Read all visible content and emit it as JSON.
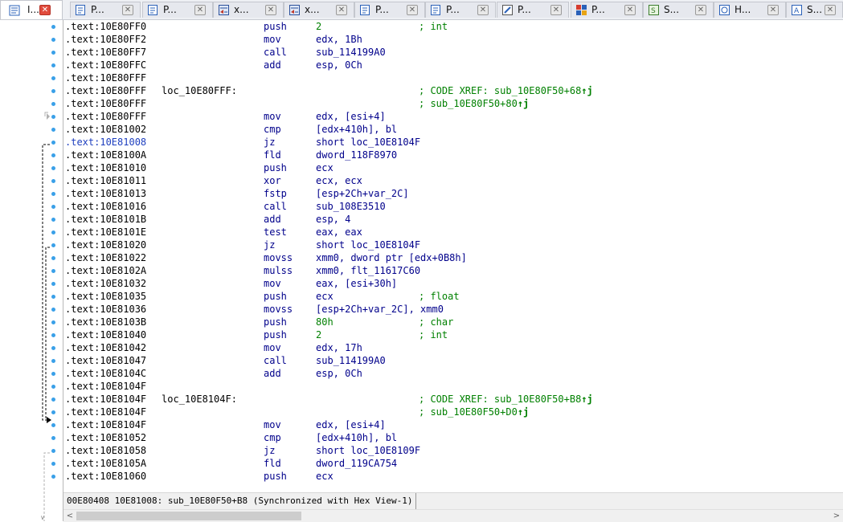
{
  "tabs": [
    {
      "label": "I...",
      "icon": "ida-view-icon",
      "active": true
    },
    {
      "label": "P...",
      "icon": "pseudocode-icon"
    },
    {
      "label": "P...",
      "icon": "pseudocode-icon"
    },
    {
      "label": "x...",
      "icon": "xrefs-icon"
    },
    {
      "label": "x...",
      "icon": "xrefs-icon"
    },
    {
      "label": "P...",
      "icon": "pseudocode-icon"
    },
    {
      "label": "P...",
      "icon": "pseudocode-icon"
    },
    {
      "label": "P...",
      "icon": "patch-icon"
    },
    {
      "label": "P...",
      "icon": "program-segmentation-icon"
    },
    {
      "label": "S...",
      "icon": "strings-icon"
    },
    {
      "label": "H...",
      "icon": "hex-view-icon"
    },
    {
      "label": "S...",
      "icon": "structures-icon"
    }
  ],
  "listing": [
    {
      "addr": ".text:10E80FF0",
      "mn": "push",
      "op": "2",
      "opnum": true,
      "cm": "; int"
    },
    {
      "addr": ".text:10E80FF2",
      "mn": "mov",
      "op": "edx, 1Bh"
    },
    {
      "addr": ".text:10E80FF7",
      "mn": "call",
      "op": "sub_114199A0"
    },
    {
      "addr": ".text:10E80FFC",
      "mn": "add",
      "op": "esp, 0Ch"
    },
    {
      "addr": ".text:10E80FFF"
    },
    {
      "addr": ".text:10E80FFF",
      "lbl": "loc_10E80FFF:",
      "cm": "; CODE XREF: sub_10E80F50+68",
      "up": "↑j"
    },
    {
      "addr": ".text:10E80FFF",
      "cm": "; sub_10E80F50+80",
      "up": "↑j"
    },
    {
      "addr": ".text:10E80FFF",
      "mn": "mov",
      "op": "edx, [esi+4]"
    },
    {
      "addr": ".text:10E81002",
      "mn": "cmp",
      "op": "[edx+410h], bl"
    },
    {
      "addr": ".text:10E81008",
      "hl": true,
      "mn": "jz",
      "op": "short loc_10E8104F"
    },
    {
      "addr": ".text:10E8100A",
      "mn": "fld",
      "op": "dword_118F8970"
    },
    {
      "addr": ".text:10E81010",
      "mn": "push",
      "op": "ecx"
    },
    {
      "addr": ".text:10E81011",
      "mn": "xor",
      "op": "ecx, ecx"
    },
    {
      "addr": ".text:10E81013",
      "mn": "fstp",
      "op": "[esp+2Ch+var_2C]"
    },
    {
      "addr": ".text:10E81016",
      "mn": "call",
      "op": "sub_108E3510"
    },
    {
      "addr": ".text:10E8101B",
      "mn": "add",
      "op": "esp, 4"
    },
    {
      "addr": ".text:10E8101E",
      "mn": "test",
      "op": "eax, eax"
    },
    {
      "addr": ".text:10E81020",
      "mn": "jz",
      "op": "short loc_10E8104F"
    },
    {
      "addr": ".text:10E81022",
      "mn": "movss",
      "op": "xmm0, dword ptr [edx+0B8h]"
    },
    {
      "addr": ".text:10E8102A",
      "mn": "mulss",
      "op": "xmm0, flt_11617C60"
    },
    {
      "addr": ".text:10E81032",
      "mn": "mov",
      "op": "eax, [esi+30h]"
    },
    {
      "addr": ".text:10E81035",
      "mn": "push",
      "op": "ecx",
      "cm": "; float"
    },
    {
      "addr": ".text:10E81036",
      "mn": "movss",
      "op": "[esp+2Ch+var_2C], xmm0"
    },
    {
      "addr": ".text:10E8103B",
      "mn": "push",
      "op": "80h",
      "opnum": true,
      "cm": "; char"
    },
    {
      "addr": ".text:10E81040",
      "mn": "push",
      "op": "2",
      "opnum": true,
      "cm": "; int"
    },
    {
      "addr": ".text:10E81042",
      "mn": "mov",
      "op": "edx, 17h"
    },
    {
      "addr": ".text:10E81047",
      "mn": "call",
      "op": "sub_114199A0"
    },
    {
      "addr": ".text:10E8104C",
      "mn": "add",
      "op": "esp, 0Ch"
    },
    {
      "addr": ".text:10E8104F"
    },
    {
      "addr": ".text:10E8104F",
      "lbl": "loc_10E8104F:",
      "cm": "; CODE XREF: sub_10E80F50+B8",
      "up": "↑j"
    },
    {
      "addr": ".text:10E8104F",
      "cm": "; sub_10E80F50+D0",
      "up": "↑j"
    },
    {
      "addr": ".text:10E8104F",
      "mn": "mov",
      "op": "edx, [esi+4]"
    },
    {
      "addr": ".text:10E81052",
      "mn": "cmp",
      "op": "[edx+410h], bl"
    },
    {
      "addr": ".text:10E81058",
      "mn": "jz",
      "op": "short loc_10E8109F"
    },
    {
      "addr": ".text:10E8105A",
      "mn": "fld",
      "op": "dword_119CA754"
    },
    {
      "addr": ".text:10E81060",
      "mn": "push",
      "op": "ecx"
    }
  ],
  "status": {
    "text": "00E80408 10E81008: sub_10E80F50+B8 (Synchronized with Hex View-1)"
  },
  "scrollbar": {
    "left_arrow": "<",
    "right_arrow": ">"
  },
  "colors": {
    "address": "#000000",
    "highlight_address": "#1e3fbf",
    "mnemonic": "#00008b",
    "comment": "#008000",
    "gutter_dot": "#3aa0e8"
  }
}
